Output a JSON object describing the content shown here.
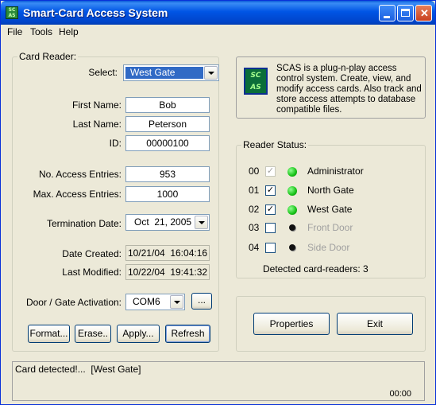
{
  "window": {
    "title": "Smart-Card Access System",
    "icon": "scas-app-icon"
  },
  "menu": [
    "File",
    "Tools",
    "Help"
  ],
  "card_reader": {
    "group_title": "Card Reader:",
    "select_label": "Select:",
    "select_value": "West Gate",
    "first_name_label": "First Name:",
    "first_name": "Bob",
    "last_name_label": "Last Name:",
    "last_name": "Peterson",
    "id_label": "ID:",
    "id": "00000100",
    "entries_label": "No. Access Entries:",
    "entries": "953",
    "max_entries_label": "Max. Access Entries:",
    "max_entries": "1000",
    "termination_label": "Termination Date:",
    "termination_date": "Oct  21, 2005",
    "created_label": "Date Created:",
    "created": "10/21/04  16:04:16",
    "modified_label": "Last Modified:",
    "modified": "10/22/04  19:41:32",
    "door_label": "Door / Gate Activation:",
    "door_port": "COM6",
    "browse_label": "...",
    "buttons": {
      "format": "Format...",
      "erase": "Erase..",
      "apply": "Apply...",
      "refresh": "Refresh"
    }
  },
  "info": {
    "icon_text_1": "SC",
    "icon_text_2": "AS",
    "text": "SCAS is a plug-n-play access control system.  Create, view, and modify access cards.  Also track and store access attempts to database compatible files."
  },
  "reader_status": {
    "group_title": "Reader Status:",
    "readers": [
      {
        "index": "00",
        "checked": true,
        "enabled": false,
        "led": "green",
        "name": "Administrator",
        "active": true
      },
      {
        "index": "01",
        "checked": true,
        "enabled": true,
        "led": "green",
        "name": "North Gate",
        "active": true
      },
      {
        "index": "02",
        "checked": true,
        "enabled": true,
        "led": "green",
        "name": "West Gate",
        "active": true
      },
      {
        "index": "03",
        "checked": false,
        "enabled": true,
        "led": "black",
        "name": "Front Door",
        "active": false
      },
      {
        "index": "04",
        "checked": false,
        "enabled": true,
        "led": "black",
        "name": "Side Door",
        "active": false
      }
    ],
    "detected_text": "Detected card-readers: 3"
  },
  "actions": {
    "properties": "Properties",
    "exit": "Exit"
  },
  "status_bar": {
    "message": "Card detected!...  [West Gate]",
    "timer": "00:00"
  },
  "colors": {
    "titlebar": "#0055e5",
    "led_on": "#17c217",
    "selection": "#316ac5"
  }
}
